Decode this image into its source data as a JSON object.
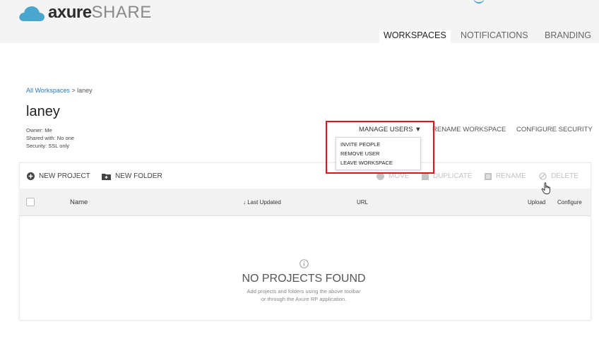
{
  "brand": {
    "logo_bold": "axure",
    "logo_light": "SHARE"
  },
  "nav": {
    "tabs": [
      {
        "label": "WORKSPACES",
        "active": true
      },
      {
        "label": "NOTIFICATIONS",
        "active": false
      },
      {
        "label": "BRANDING",
        "active": false
      }
    ]
  },
  "breadcrumb": {
    "root": "All Workspaces",
    "separator": " > ",
    "current": "laney"
  },
  "workspace": {
    "title": "laney",
    "owner": "Owner: Me",
    "shared": "Shared with: No one",
    "security": "Security: SSL only"
  },
  "actions": {
    "manage_users": "MANAGE USERS ▼",
    "rename_workspace": "RENAME WORKSPACE",
    "configure_security": "CONFIGURE SECURITY"
  },
  "manage_menu": {
    "items": [
      "INVITE PEOPLE",
      "REMOVE USER",
      "LEAVE WORKSPACE"
    ]
  },
  "toolbar": {
    "new_project": "NEW PROJECT",
    "new_folder": "NEW FOLDER",
    "move": "MOVE",
    "duplicate": "DUPLICATE",
    "rename": "RENAME",
    "delete": "DELETE"
  },
  "table": {
    "headers": {
      "name": "Name",
      "last_updated": "Last Updated",
      "url": "URL",
      "upload": "Upload",
      "configure": "Configure"
    },
    "sort_icon": "↓"
  },
  "empty": {
    "title": "NO PROJECTS FOUND",
    "line1": "Add projects and folders using the above toolbar",
    "line2": "or through the Axure RP application."
  },
  "colors": {
    "accent": "#2a7ab8",
    "highlight": "#e0141a",
    "logo_blue": "#49a6cf"
  }
}
